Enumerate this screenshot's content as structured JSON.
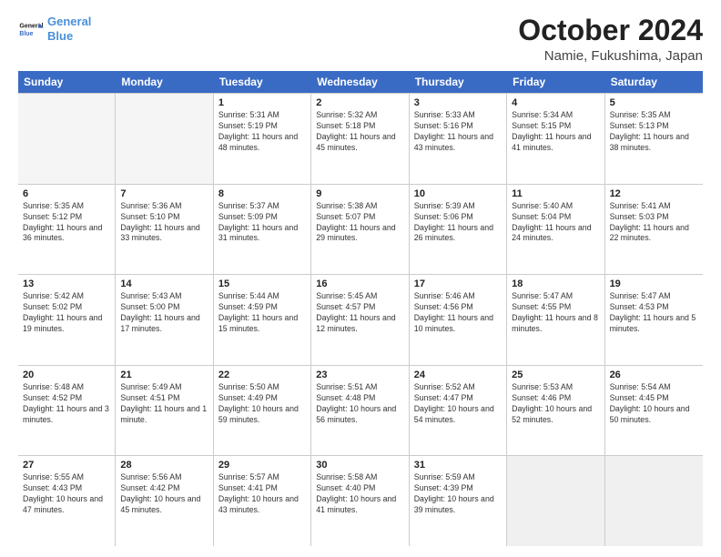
{
  "logo": {
    "line1": "General",
    "line2": "Blue"
  },
  "title": "October 2024",
  "location": "Namie, Fukushima, Japan",
  "weekdays": [
    "Sunday",
    "Monday",
    "Tuesday",
    "Wednesday",
    "Thursday",
    "Friday",
    "Saturday"
  ],
  "weeks": [
    [
      {
        "day": "",
        "info": "",
        "empty": true
      },
      {
        "day": "",
        "info": "",
        "empty": true
      },
      {
        "day": "1",
        "info": "Sunrise: 5:31 AM\nSunset: 5:19 PM\nDaylight: 11 hours and 48 minutes."
      },
      {
        "day": "2",
        "info": "Sunrise: 5:32 AM\nSunset: 5:18 PM\nDaylight: 11 hours and 45 minutes."
      },
      {
        "day": "3",
        "info": "Sunrise: 5:33 AM\nSunset: 5:16 PM\nDaylight: 11 hours and 43 minutes."
      },
      {
        "day": "4",
        "info": "Sunrise: 5:34 AM\nSunset: 5:15 PM\nDaylight: 11 hours and 41 minutes."
      },
      {
        "day": "5",
        "info": "Sunrise: 5:35 AM\nSunset: 5:13 PM\nDaylight: 11 hours and 38 minutes."
      }
    ],
    [
      {
        "day": "6",
        "info": "Sunrise: 5:35 AM\nSunset: 5:12 PM\nDaylight: 11 hours and 36 minutes."
      },
      {
        "day": "7",
        "info": "Sunrise: 5:36 AM\nSunset: 5:10 PM\nDaylight: 11 hours and 33 minutes."
      },
      {
        "day": "8",
        "info": "Sunrise: 5:37 AM\nSunset: 5:09 PM\nDaylight: 11 hours and 31 minutes."
      },
      {
        "day": "9",
        "info": "Sunrise: 5:38 AM\nSunset: 5:07 PM\nDaylight: 11 hours and 29 minutes."
      },
      {
        "day": "10",
        "info": "Sunrise: 5:39 AM\nSunset: 5:06 PM\nDaylight: 11 hours and 26 minutes."
      },
      {
        "day": "11",
        "info": "Sunrise: 5:40 AM\nSunset: 5:04 PM\nDaylight: 11 hours and 24 minutes."
      },
      {
        "day": "12",
        "info": "Sunrise: 5:41 AM\nSunset: 5:03 PM\nDaylight: 11 hours and 22 minutes."
      }
    ],
    [
      {
        "day": "13",
        "info": "Sunrise: 5:42 AM\nSunset: 5:02 PM\nDaylight: 11 hours and 19 minutes."
      },
      {
        "day": "14",
        "info": "Sunrise: 5:43 AM\nSunset: 5:00 PM\nDaylight: 11 hours and 17 minutes."
      },
      {
        "day": "15",
        "info": "Sunrise: 5:44 AM\nSunset: 4:59 PM\nDaylight: 11 hours and 15 minutes."
      },
      {
        "day": "16",
        "info": "Sunrise: 5:45 AM\nSunset: 4:57 PM\nDaylight: 11 hours and 12 minutes."
      },
      {
        "day": "17",
        "info": "Sunrise: 5:46 AM\nSunset: 4:56 PM\nDaylight: 11 hours and 10 minutes."
      },
      {
        "day": "18",
        "info": "Sunrise: 5:47 AM\nSunset: 4:55 PM\nDaylight: 11 hours and 8 minutes."
      },
      {
        "day": "19",
        "info": "Sunrise: 5:47 AM\nSunset: 4:53 PM\nDaylight: 11 hours and 5 minutes."
      }
    ],
    [
      {
        "day": "20",
        "info": "Sunrise: 5:48 AM\nSunset: 4:52 PM\nDaylight: 11 hours and 3 minutes."
      },
      {
        "day": "21",
        "info": "Sunrise: 5:49 AM\nSunset: 4:51 PM\nDaylight: 11 hours and 1 minute."
      },
      {
        "day": "22",
        "info": "Sunrise: 5:50 AM\nSunset: 4:49 PM\nDaylight: 10 hours and 59 minutes."
      },
      {
        "day": "23",
        "info": "Sunrise: 5:51 AM\nSunset: 4:48 PM\nDaylight: 10 hours and 56 minutes."
      },
      {
        "day": "24",
        "info": "Sunrise: 5:52 AM\nSunset: 4:47 PM\nDaylight: 10 hours and 54 minutes."
      },
      {
        "day": "25",
        "info": "Sunrise: 5:53 AM\nSunset: 4:46 PM\nDaylight: 10 hours and 52 minutes."
      },
      {
        "day": "26",
        "info": "Sunrise: 5:54 AM\nSunset: 4:45 PM\nDaylight: 10 hours and 50 minutes."
      }
    ],
    [
      {
        "day": "27",
        "info": "Sunrise: 5:55 AM\nSunset: 4:43 PM\nDaylight: 10 hours and 47 minutes."
      },
      {
        "day": "28",
        "info": "Sunrise: 5:56 AM\nSunset: 4:42 PM\nDaylight: 10 hours and 45 minutes."
      },
      {
        "day": "29",
        "info": "Sunrise: 5:57 AM\nSunset: 4:41 PM\nDaylight: 10 hours and 43 minutes."
      },
      {
        "day": "30",
        "info": "Sunrise: 5:58 AM\nSunset: 4:40 PM\nDaylight: 10 hours and 41 minutes."
      },
      {
        "day": "31",
        "info": "Sunrise: 5:59 AM\nSunset: 4:39 PM\nDaylight: 10 hours and 39 minutes."
      },
      {
        "day": "",
        "info": "",
        "empty": true
      },
      {
        "day": "",
        "info": "",
        "empty": true
      }
    ]
  ]
}
